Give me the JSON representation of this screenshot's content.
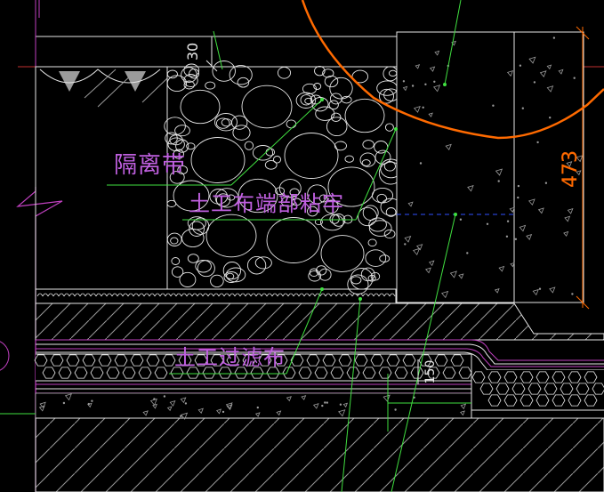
{
  "drawing": {
    "labels": {
      "isolation_strip": "隔离带",
      "geotextile_end_bond": "土工布端部粘牢",
      "geotextile_filter": "土工过滤布",
      "dim_473": "473",
      "dim_150": "150",
      "dim_top": "30"
    },
    "colors": {
      "background": "#000000",
      "magenta": "#c040c0",
      "white": "#e6e6e6",
      "green": "#40e040",
      "orange": "#ff6a00",
      "blue": "#3050ff",
      "red": "#c03030",
      "hatch": "#b0b0b0",
      "label": "#c060e0"
    }
  }
}
